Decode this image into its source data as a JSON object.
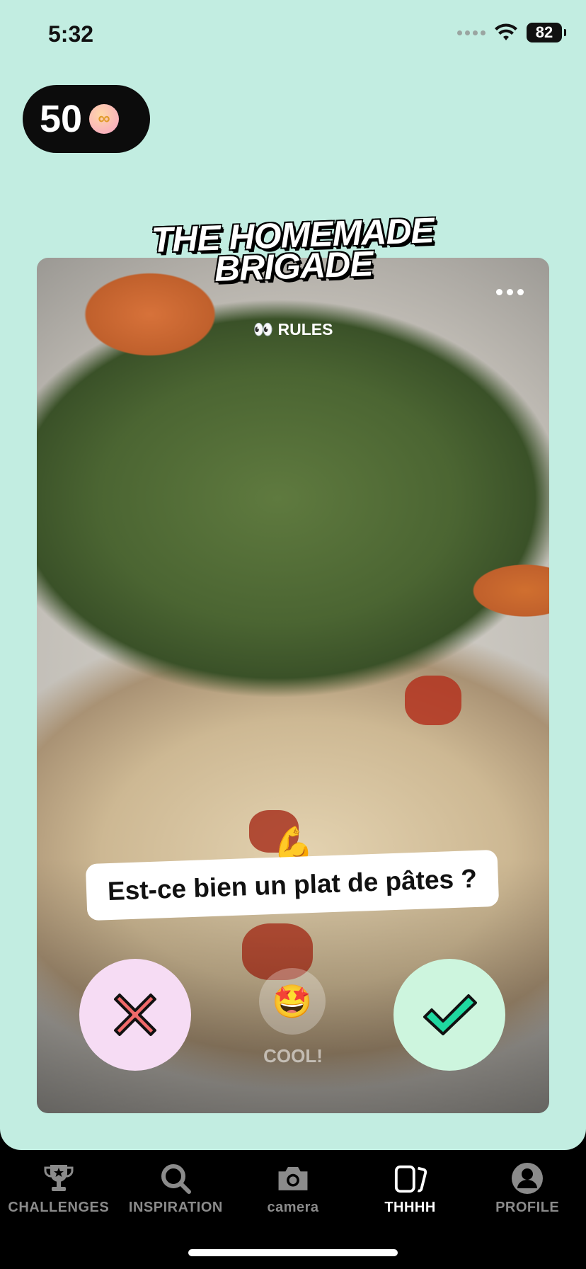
{
  "status_bar": {
    "time": "5:32",
    "battery": "82"
  },
  "coins": {
    "count": "50",
    "icon": "coin-icon"
  },
  "challenge": {
    "title_line1": "THE HOMEMADE",
    "title_line2": "BRIGADE"
  },
  "card": {
    "rules_label": "👀 RULES",
    "caption_emoji": "💪",
    "caption": "Est-ce bien un plat de pâtes ?",
    "cool_emoji": "🤩",
    "cool_label": "COOL!"
  },
  "tabs": [
    {
      "label": "CHALLENGES",
      "icon": "trophy-icon"
    },
    {
      "label": "INSPIRATION",
      "icon": "search-icon"
    },
    {
      "label": "camera",
      "icon": "camera-icon"
    },
    {
      "label": "THHHH",
      "icon": "cards-icon",
      "active": true
    },
    {
      "label": "PROFILE",
      "icon": "profile-icon"
    }
  ],
  "colors": {
    "background": "#c2ede1",
    "reject": "#f6dcf4",
    "approve": "#cdf5de",
    "accent_green": "#1fd8a0",
    "accent_red": "#f06a6a"
  }
}
